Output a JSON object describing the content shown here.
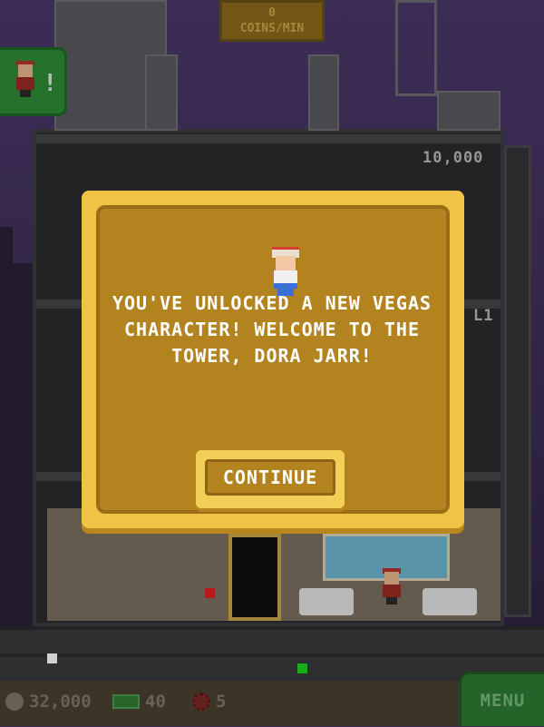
{
  "hud": {
    "coin_rate_value": "0",
    "coin_rate_label": "COINS/MIN",
    "floor_top_label": "10,000",
    "floor_side_label": "L1"
  },
  "dialog": {
    "message": "YOU'VE UNLOCKED A NEW VEGAS CHARACTER! WELCOME TO THE TOWER, DORA JARR!",
    "continue_label": "CONTINUE"
  },
  "bottom_bar": {
    "coins": "32,000",
    "bux": "40",
    "gears": "5",
    "menu_label": "MENU"
  },
  "colors": {
    "dialog_border": "#f0c346",
    "dialog_fill": "#b3831f",
    "menu_green": "#2e7a33",
    "sky": "#3b2e52"
  }
}
